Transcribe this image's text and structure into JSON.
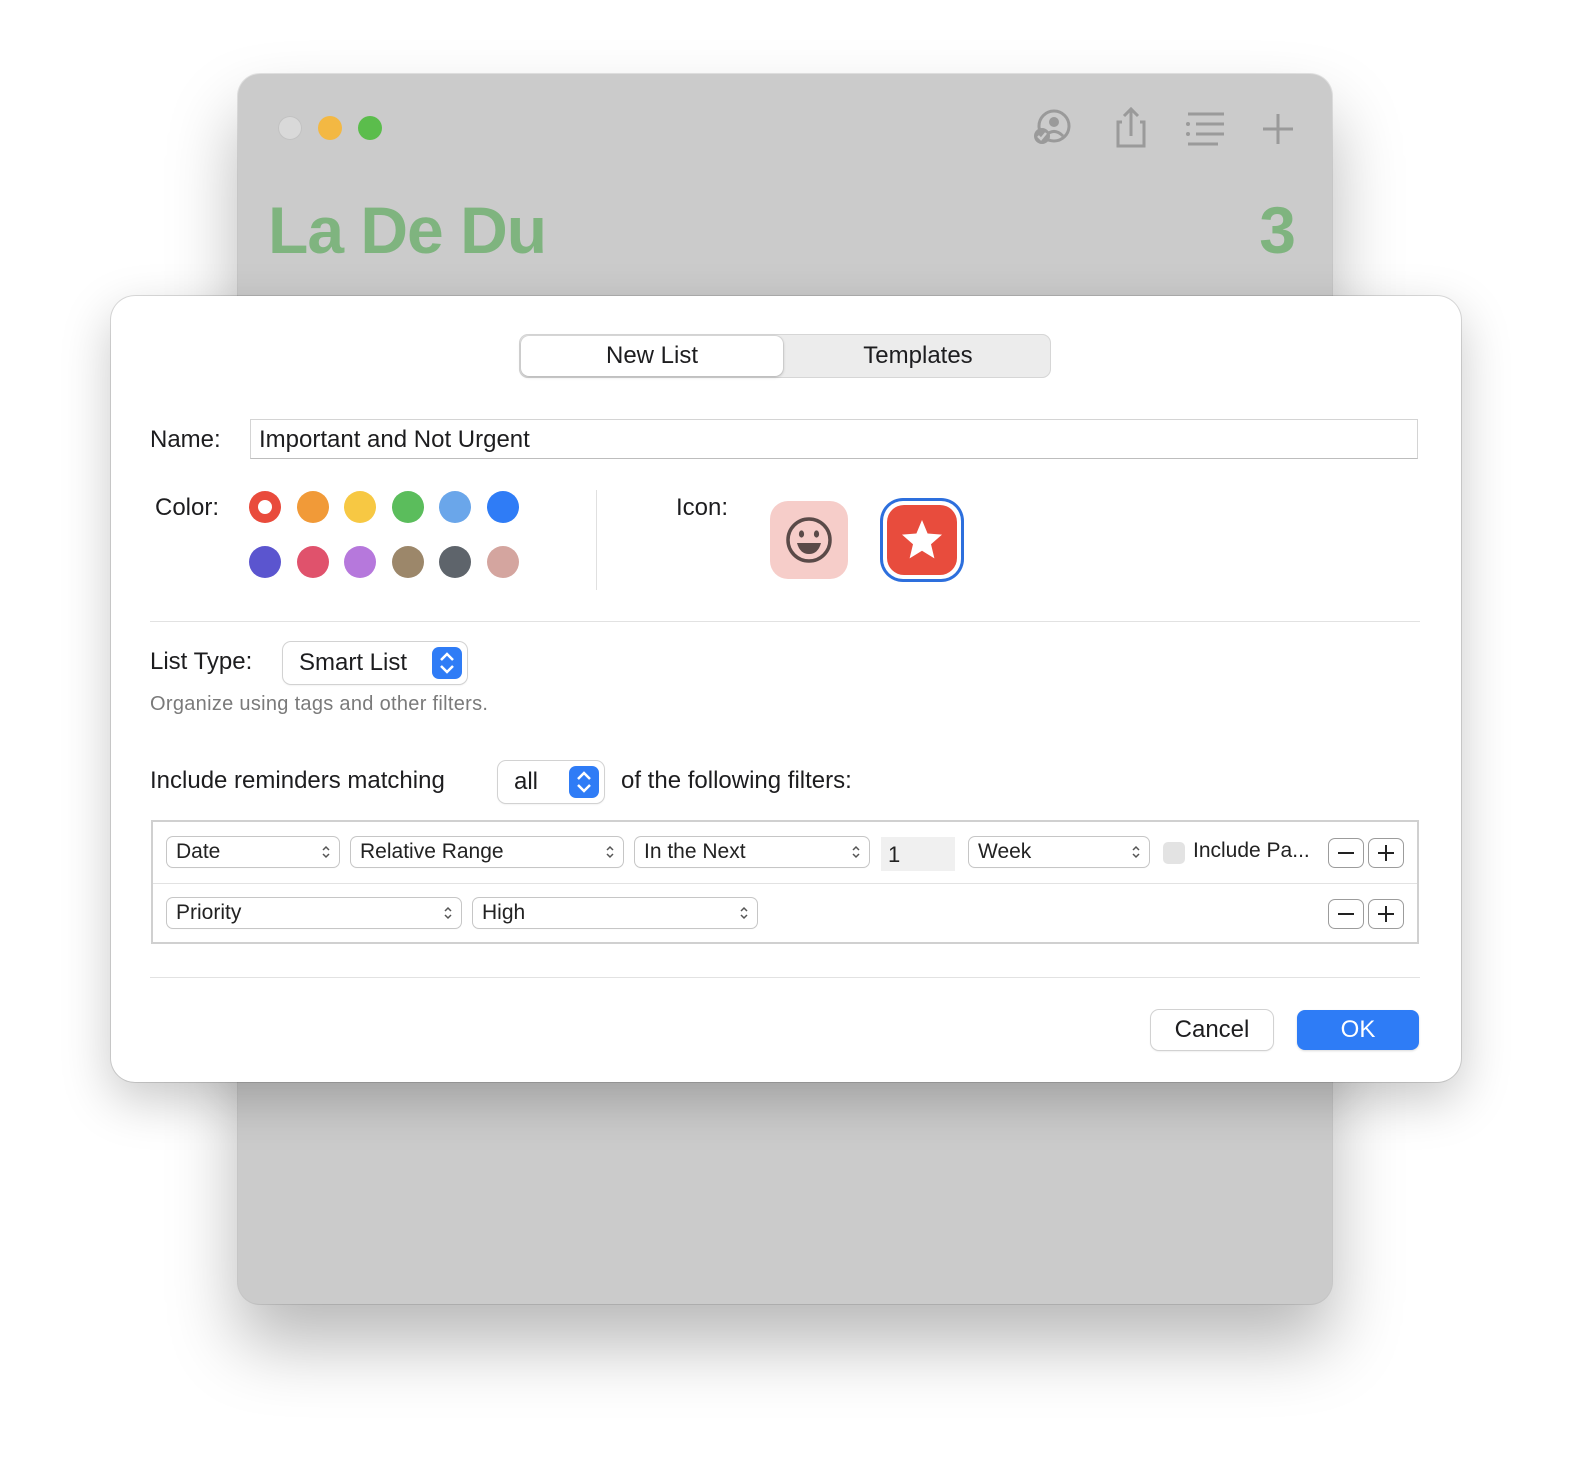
{
  "background_window": {
    "title": "La De Du",
    "count": "3",
    "title_color": "#7fb47f",
    "toolbar_icons": [
      "shared-with-icon",
      "share-icon",
      "list-view-icon",
      "add-icon"
    ]
  },
  "dialog": {
    "tabs": [
      {
        "label": "New List",
        "selected": true
      },
      {
        "label": "Templates",
        "selected": false
      }
    ],
    "name": {
      "label": "Name:",
      "value": "Important and Not Urgent"
    },
    "color": {
      "label": "Color:",
      "selected_index": 0,
      "swatches": [
        "#e94b3c",
        "#f19a38",
        "#f7c843",
        "#5bbd5c",
        "#6aa6ea",
        "#2f7cf6",
        "#5b55cf",
        "#e0526c",
        "#b678dc",
        "#9c876a",
        "#5e646b",
        "#d4a59f"
      ]
    },
    "icon": {
      "label": "Icon:",
      "options": [
        "smiley-icon",
        "star-icon"
      ],
      "selected": "star-icon"
    },
    "list_type": {
      "label": "List Type:",
      "value": "Smart List",
      "description": "Organize using tags and other filters."
    },
    "match": {
      "prefix": "Include reminders matching",
      "value": "all",
      "suffix": "of the following filters:"
    },
    "filters": {
      "row1": {
        "field": "Date",
        "operator": "Relative Range",
        "relation": "In the Next",
        "amount": "1",
        "unit": "Week",
        "include_label": "Include Pa..."
      },
      "row2": {
        "field": "Priority",
        "value": "High"
      }
    },
    "buttons": {
      "cancel": "Cancel",
      "ok": "OK"
    },
    "accent_color": "#2e7cf6"
  }
}
